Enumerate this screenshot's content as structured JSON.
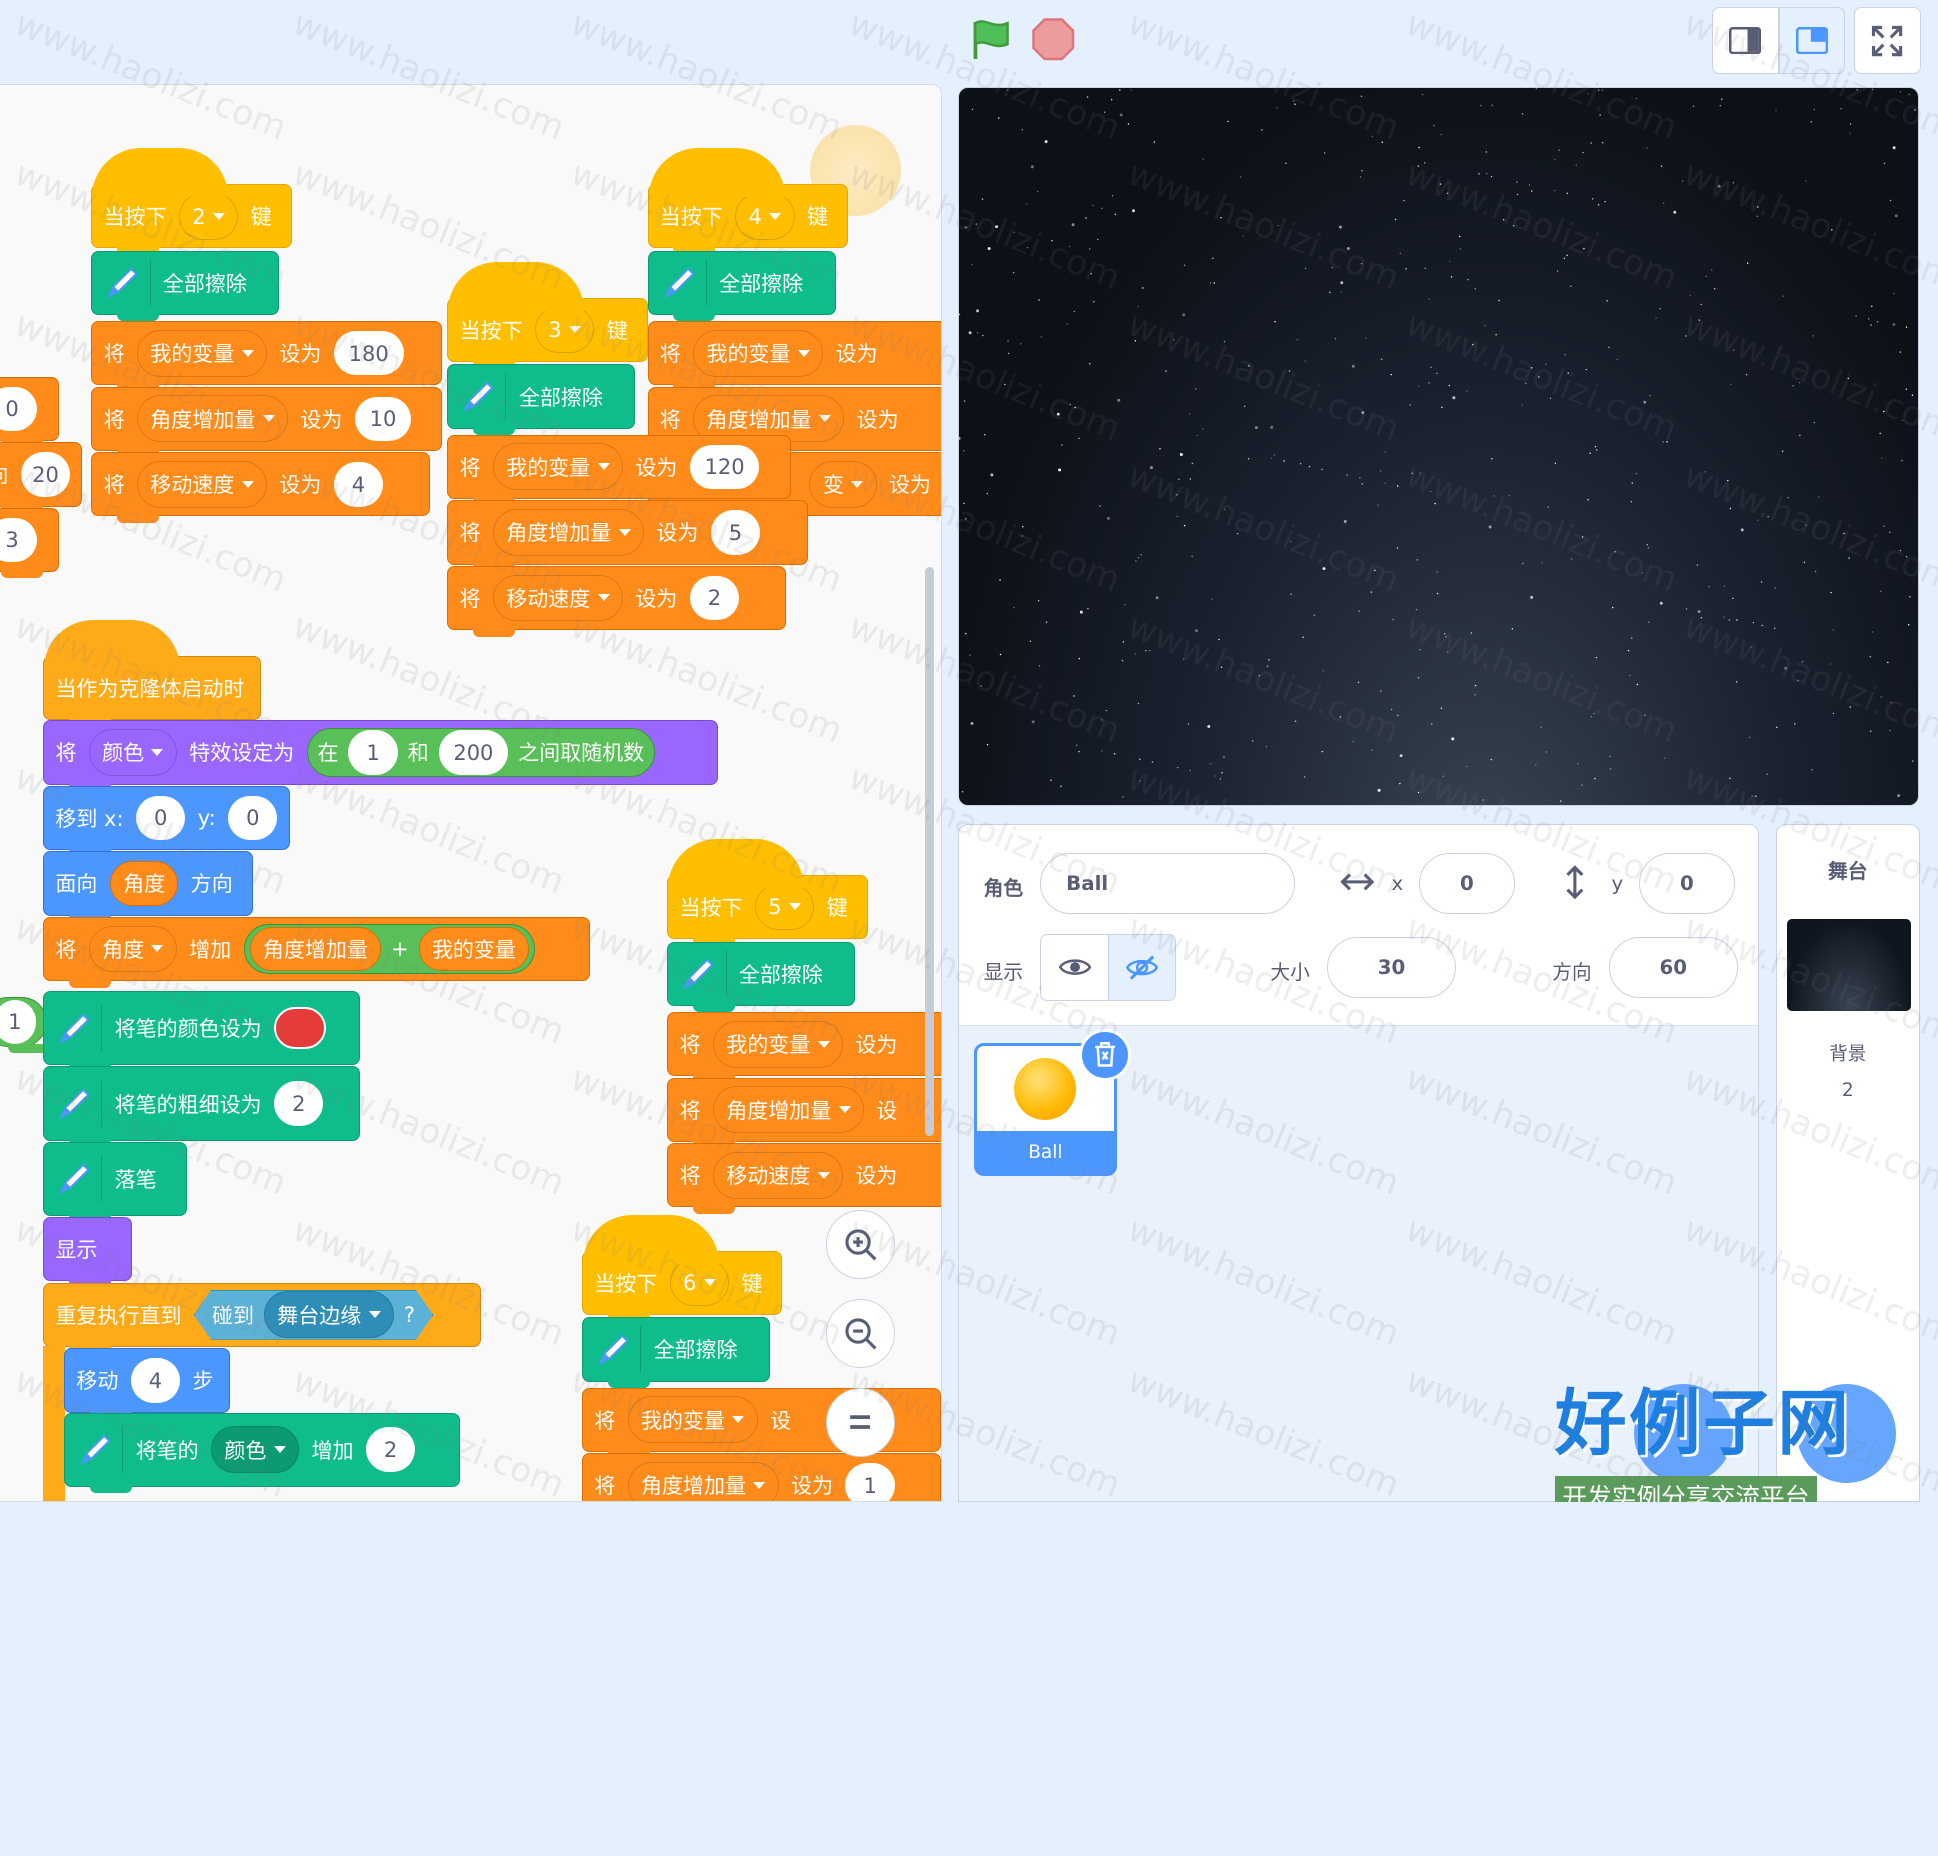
{
  "header": {
    "green_flag": "green-flag-icon",
    "stop": "stop-icon",
    "layout": [
      "small-stage-icon",
      "normal-stage-icon",
      "fullscreen-icon"
    ]
  },
  "workspace": {
    "stack2": {
      "event_label": "当按下",
      "key": "2",
      "key_suffix": "键",
      "erase": "全部擦除",
      "set": "将",
      "to": "设为",
      "rows": [
        {
          "var": "我的变量",
          "val": "180"
        },
        {
          "var": "角度增加量",
          "val": "10"
        },
        {
          "var": "移动速度",
          "val": "4"
        }
      ]
    },
    "stack3": {
      "event_label": "当按下",
      "key": "3",
      "key_suffix": "键",
      "erase": "全部擦除",
      "set": "将",
      "to": "设为",
      "rows": [
        {
          "var": "我的变量",
          "val": "120"
        },
        {
          "var": "角度增加量",
          "val": "5"
        },
        {
          "var": "移动速度",
          "val": "2"
        }
      ]
    },
    "stack4": {
      "event_label": "当按下",
      "key": "4",
      "key_suffix": "键",
      "erase": "全部擦除",
      "set": "将",
      "to": "设为",
      "rows": [
        {
          "var": "我的变量"
        },
        {
          "var": "角度增加量"
        },
        {
          "var": "变"
        }
      ]
    },
    "left_partial": {
      "a": "0",
      "b": "20",
      "c": "3",
      "d": "1",
      "b_prefix": "向"
    },
    "clone": {
      "hat": "当作为克隆体启动时",
      "effect": {
        "set": "将",
        "effect": "颜色",
        "label": "特效设定为",
        "pick_in": "在",
        "from": "1",
        "and": "和",
        "to": "200",
        "pick_tail": "之间取随机数"
      },
      "goto": {
        "label": "移到 x:",
        "x": "0",
        "ylabel": "y:",
        "y": "0"
      },
      "point": {
        "label": "面向",
        "var": "角度",
        "tail": "方向"
      },
      "change": {
        "set": "将",
        "var": "角度",
        "label": "增加",
        "a": "角度增加量",
        "plus": "+",
        "b": "我的变量"
      },
      "pencolor": "将笔的颜色设为",
      "pensize": {
        "label": "将笔的粗细设为",
        "val": "2"
      },
      "pendown": "落笔",
      "show": "显示",
      "repeat": {
        "label": "重复执行直到",
        "touch": "碰到",
        "target": "舞台边缘",
        "q": "?"
      },
      "move": {
        "label": "移动",
        "val": "4",
        "tail": "步"
      },
      "penchange": {
        "label": "将笔的",
        "param": "颜色",
        "mid": "增加",
        "val": "2"
      }
    },
    "stack5": {
      "event_label": "当按下",
      "key": "5",
      "key_suffix": "键",
      "erase": "全部擦除",
      "set": "将",
      "to": "设为",
      "rows": [
        {
          "var": "我的变量",
          "to": "设为"
        },
        {
          "var": "角度增加量",
          "to": "设"
        },
        {
          "var": "移动速度",
          "to": "设为"
        }
      ]
    },
    "stack6": {
      "event_label": "当按下",
      "key": "6",
      "key_suffix": "键",
      "erase": "全部擦除",
      "set": "将",
      "to": "设为",
      "rows": [
        {
          "var": "我的变量",
          "to": "设"
        },
        {
          "var": "角度增加量",
          "to": "设为",
          "val": "1"
        }
      ]
    },
    "pen_color": "#e63b3b"
  },
  "sprite_info": {
    "sprite_label": "角色",
    "sprite_name": "Ball",
    "x_label": "x",
    "x": "0",
    "y_label": "y",
    "y": "0",
    "show_label": "显示",
    "size_label": "大小",
    "size": "30",
    "dir_label": "方向",
    "dir": "60"
  },
  "sprite_list": [
    {
      "name": "Ball"
    }
  ],
  "stage_panel": {
    "title": "舞台",
    "backdrop_label": "背景",
    "backdrop_count": "2"
  },
  "watermark": {
    "text": "www.haolizi.com",
    "logo_main": "好例子网",
    "logo_sub": "开发实例分享交流平台"
  },
  "colors": {
    "event": "#ffbf00",
    "pen": "#0fbd8c",
    "variables": "#ff8c1a",
    "looks": "#9966ff",
    "motion": "#4c97ff",
    "control": "#ffab19",
    "operators": "#59c059",
    "sensing": "#5cb1d6"
  }
}
